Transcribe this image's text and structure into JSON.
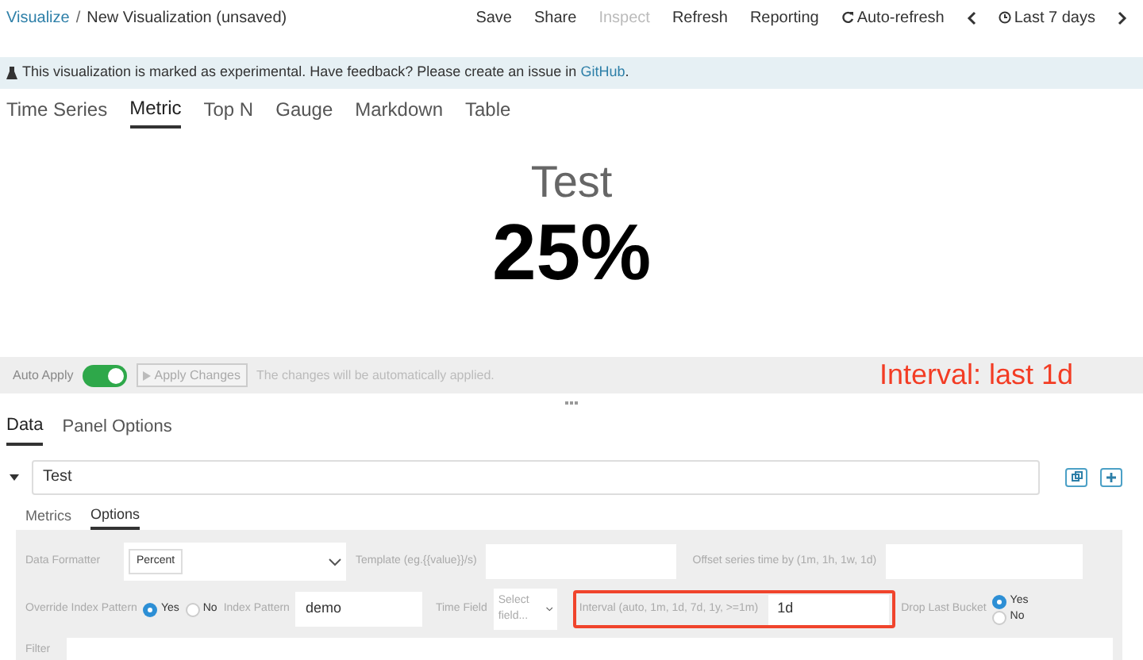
{
  "breadcrumbs": [
    {
      "label": "Visualize",
      "kind": "link"
    },
    {
      "label": "New Visualization (unsaved)",
      "kind": "current"
    }
  ],
  "breadcrumb_separator": "/",
  "top_menu": [
    {
      "label": "Save",
      "disabled": false,
      "kind": "text"
    },
    {
      "label": "Share",
      "disabled": false,
      "kind": "text"
    },
    {
      "label": "Inspect",
      "disabled": true,
      "kind": "text"
    },
    {
      "label": "Refresh",
      "disabled": false,
      "kind": "text"
    },
    {
      "label": "Reporting",
      "disabled": false,
      "kind": "text"
    },
    {
      "label": "Auto-refresh",
      "disabled": false,
      "kind": "refresh"
    },
    {
      "disabled": false,
      "kind": "prev"
    },
    {
      "label": "Last 7 days",
      "disabled": false,
      "kind": "time"
    },
    {
      "disabled": false,
      "kind": "next"
    }
  ],
  "banner": {
    "text": "This visualization is marked as experimental. Have feedback? Please create an issue in",
    "link": "GitHub",
    "end": "."
  },
  "viz_tabs": [
    {
      "label": "Time Series",
      "selected": false
    },
    {
      "label": "Metric",
      "selected": true
    },
    {
      "label": "Top N",
      "selected": false
    },
    {
      "label": "Gauge",
      "selected": false
    },
    {
      "label": "Markdown",
      "selected": false
    },
    {
      "label": "Table",
      "selected": false
    }
  ],
  "metric": {
    "label": "Test",
    "value": "25%"
  },
  "apply_bar": {
    "label": "Auto Apply",
    "auto_apply": true,
    "button": "Apply Changes",
    "button_disabled": true,
    "message": "The changes will be automatically applied."
  },
  "annotation": "Interval: last 1d",
  "panel_tabs": [
    {
      "label": "Data",
      "selected": true
    },
    {
      "label": "Panel Options",
      "selected": false
    }
  ],
  "series": {
    "label": "Test",
    "expanded": true
  },
  "series_tabs": [
    {
      "label": "Metrics",
      "selected": false
    },
    {
      "label": "Options",
      "selected": true
    }
  ],
  "options": {
    "data_formatter": {
      "label": "Data Formatter",
      "value": "Percent"
    },
    "template": {
      "label": "Template (eg.{{value}}/s)"
    },
    "offset": {
      "label": "Offset series time by (1m, 1h, 1w, 1d)"
    },
    "override": {
      "label": "Override Index Pattern",
      "choices": [
        {
          "label": "Yes",
          "selected": true
        },
        {
          "label": "No",
          "selected": false
        }
      ]
    },
    "index_pattern": {
      "label": "Index Pattern",
      "value": "demo"
    },
    "time_field": {
      "label": "Time Field",
      "placeholder": "Select field..."
    },
    "interval": {
      "label": "Interval (auto, 1m, 1d, 7d, 1y, >=1m)",
      "value": "1d",
      "highlighted": true
    },
    "drop_last_bucket": {
      "label": "Drop Last Bucket",
      "choices": [
        {
          "label": "Yes",
          "selected": true
        },
        {
          "label": "No",
          "selected": false
        }
      ]
    },
    "filter": {
      "label": "Filter"
    }
  }
}
